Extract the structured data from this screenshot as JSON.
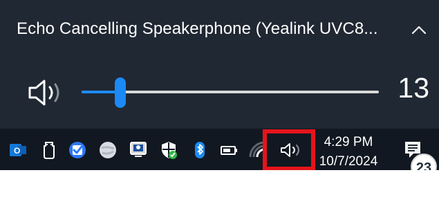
{
  "flyout": {
    "device_name": "Echo Cancelling Speakerphone (Yealink UVC8...",
    "volume": {
      "value": "13",
      "level": 0.13
    },
    "icons": {
      "speaker": "speaker-volume-icon",
      "expand": "chevron-up-icon"
    },
    "colors": {
      "background": "#202833",
      "accent": "#1c8af5",
      "track": "#d9d9d9"
    }
  },
  "taskbar": {
    "icons": [
      "outlook-icon",
      "usb-drive-icon",
      "check-app-icon",
      "globe-app-icon",
      "screen-app-icon",
      "security-shield-icon",
      "bluetooth-icon",
      "battery-icon",
      "wifi-icon",
      "volume-icon"
    ],
    "clock": {
      "time": "4:29 PM",
      "date": "10/7/2024"
    },
    "notifications": {
      "count": "23",
      "icon": "notification-center-icon"
    }
  },
  "highlight": {
    "color": "#e5141b",
    "pointer": "red-arrow-cursor-icon"
  }
}
